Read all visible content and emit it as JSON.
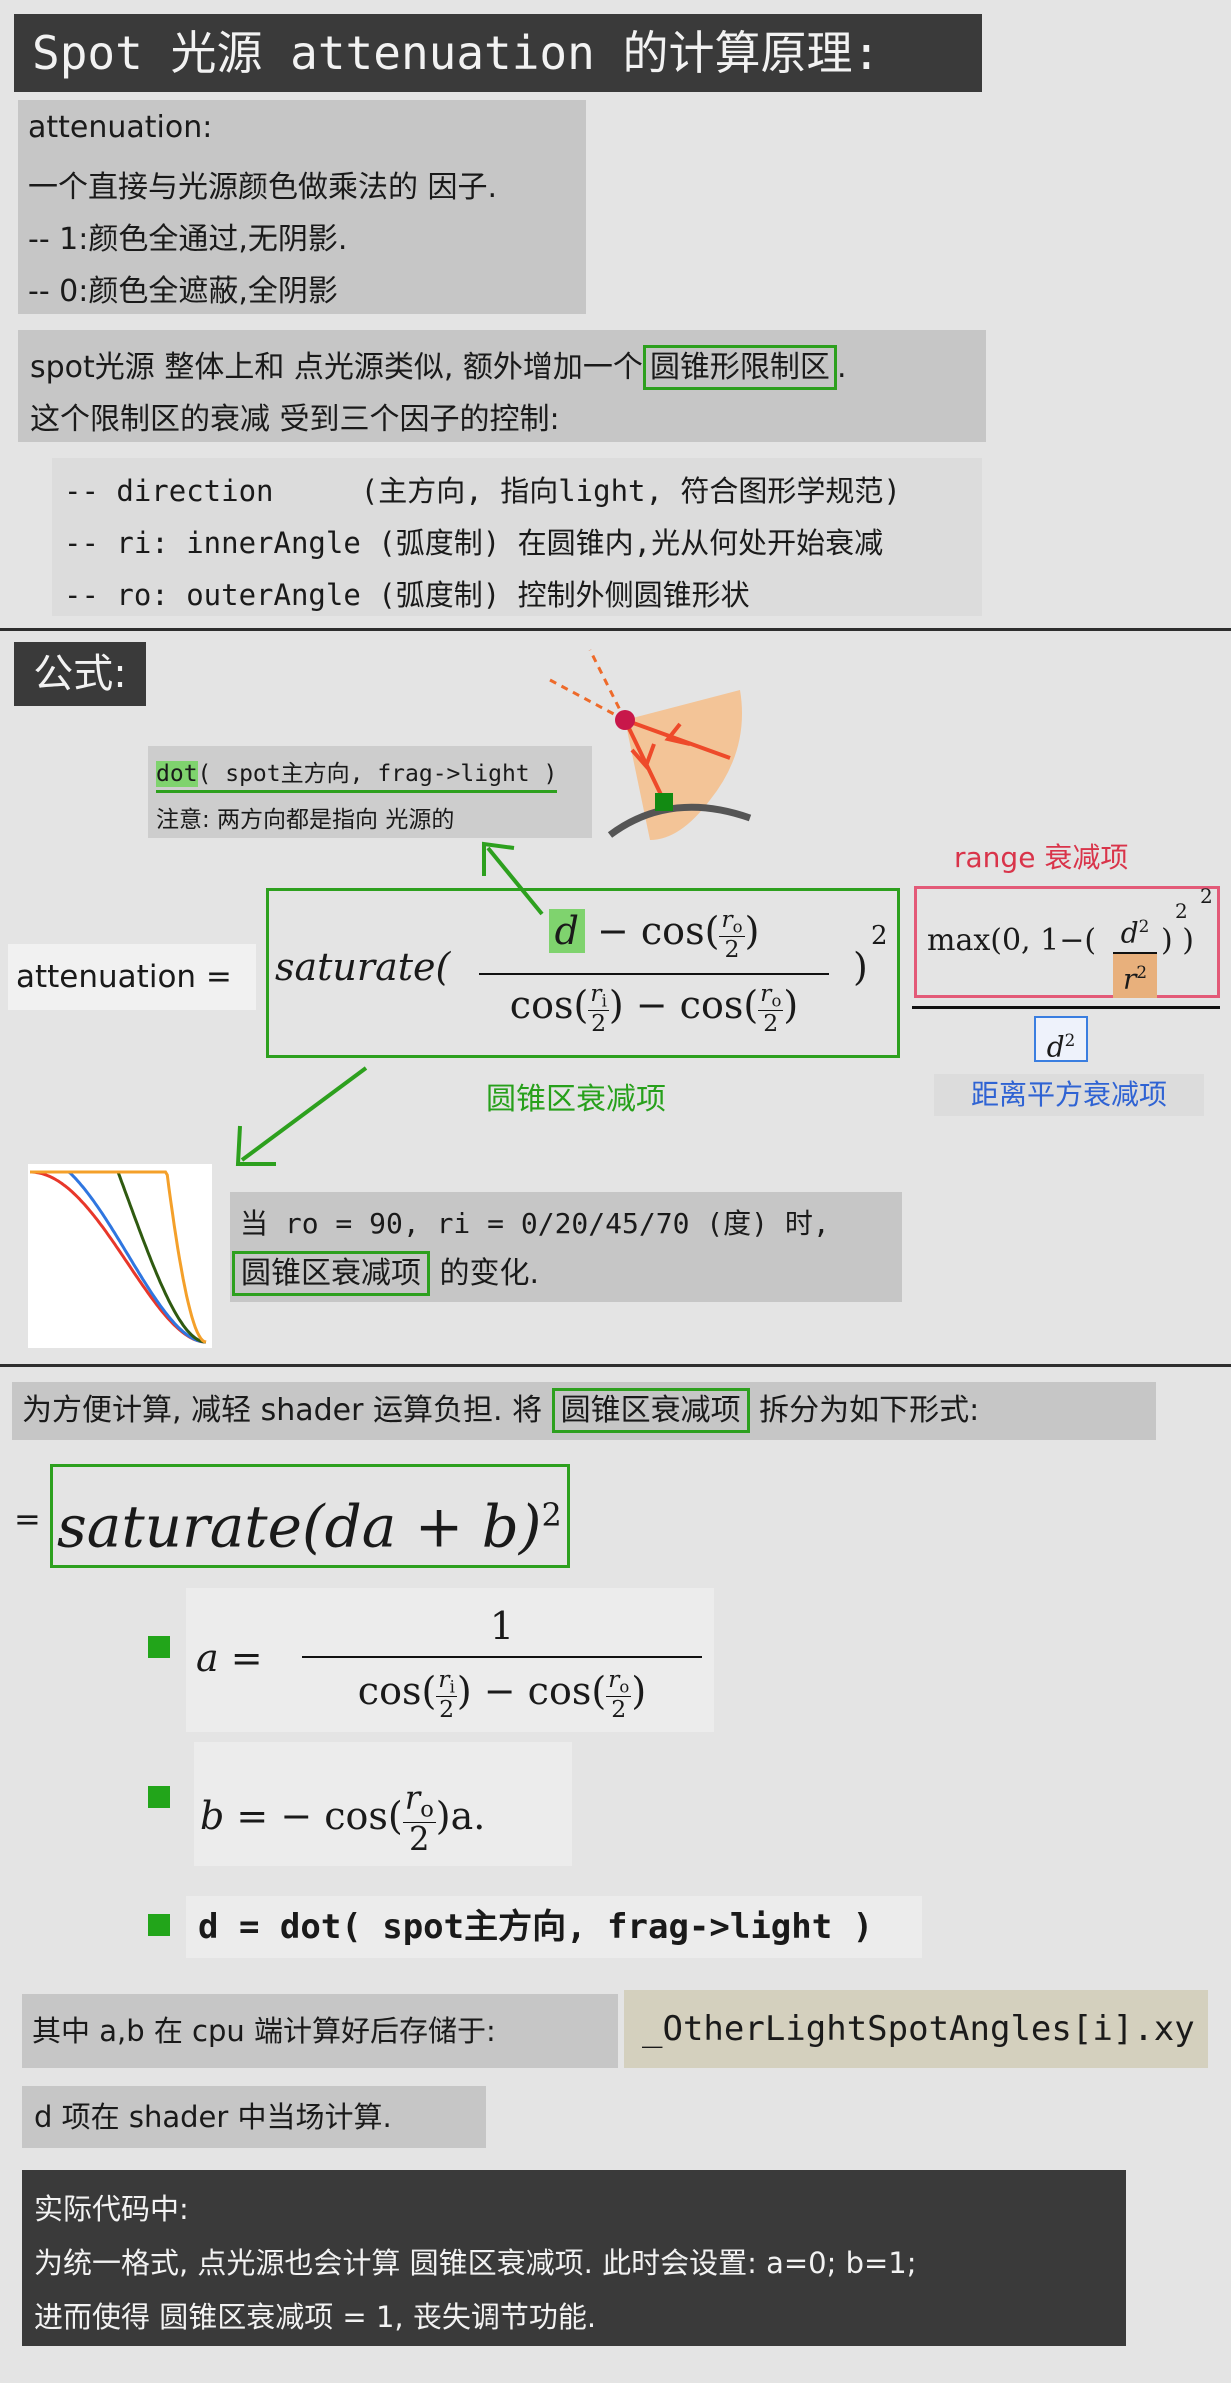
{
  "title": "Spot 光源 attenuation 的计算原理:",
  "attn_def": {
    "lines": [
      "attenuation:",
      "一个直接与光源颜色做乘法的 因子.",
      "-- 1:颜色全通过,无阴影.",
      "-- 0:颜色全遮蔽,全阴影"
    ]
  },
  "spot_intro": {
    "line1_pre": "spot光源 整体上和 点光源类似, 额外增加一个",
    "line1_box": "圆锥形限制区",
    "line1_post": ".",
    "line2": "这个限制区的衰减 受到三个因子的控制:"
  },
  "factors": [
    "-- direction     (主方向, 指向light, 符合图形学规范)",
    "-- ri: innerAngle (弧度制) 在圆锥内,光从何处开始衰减",
    "-- ro: outerAngle (弧度制) 控制外侧圆锥形状"
  ],
  "formula_heading": "公式:",
  "dot_note": {
    "dot": "dot",
    "args": "( spot主方向, frag->light )",
    "note": "注意: 两方向都是指向 光源的"
  },
  "formula": {
    "lhs": "attenuation =",
    "saturate": "saturate(",
    "d": "d",
    "minus_cos": " − cos(",
    "close": ")",
    "r_o": "r",
    "sub_o": "o",
    "r_i": "r",
    "sub_i": "i",
    "two": "2",
    "cos": "cos(",
    "minus": " − ",
    "close_paren": ")",
    "square": "2",
    "max_pre": "max(0, 1−(",
    "d2": "d",
    "r2": "r",
    "sup2": "2",
    "max_post": ") )",
    "den_d2": "d",
    "cone_label": "圆锥区衰减项",
    "range_label": "range 衰减项",
    "dist_label": "距离平方衰减项"
  },
  "example_note": {
    "line1": "当 ro = 90, ri = 0/20/45/70 (度) 时,",
    "line2_box": "圆锥区衰减项",
    "line2_post": " 的变化."
  },
  "curve_colors": [
    "#e8372a",
    "#2f76e0",
    "#2f5a10",
    "#f4a02a"
  ],
  "simplify": {
    "pre": "为方便计算, 减轻 shader 运算负担. 将 ",
    "box": "圆锥区衰减项",
    "post": " 拆分为如下形式:"
  },
  "simplified": {
    "eq": "=",
    "saturate": "saturate",
    "body": "(da + b)",
    "sup": "2"
  },
  "a_def": {
    "lhs": "a =",
    "num": "1",
    "cos": "cos(",
    "minus": ") − cos(",
    "close": ")"
  },
  "b_def": {
    "lhs": "b =",
    "rhs_pre": " − cos(",
    "rhs_post": ")a."
  },
  "d_def": "d = dot( spot主方向, frag->light )",
  "storage": {
    "pre": "其中 a,b 在 cpu 端计算好后存储于:",
    "var": "_OtherLightSpotAngles[i].xy"
  },
  "d_note": "d 项在 shader 中当场计算.",
  "code_note": {
    "lines": [
      "实际代码中:",
      "为统一格式, 点光源也会计算 圆锥区衰减项. 此时会设置: a=0; b=1;",
      "进而使得 圆锥区衰减项 = 1, 丧失调节功能."
    ]
  }
}
